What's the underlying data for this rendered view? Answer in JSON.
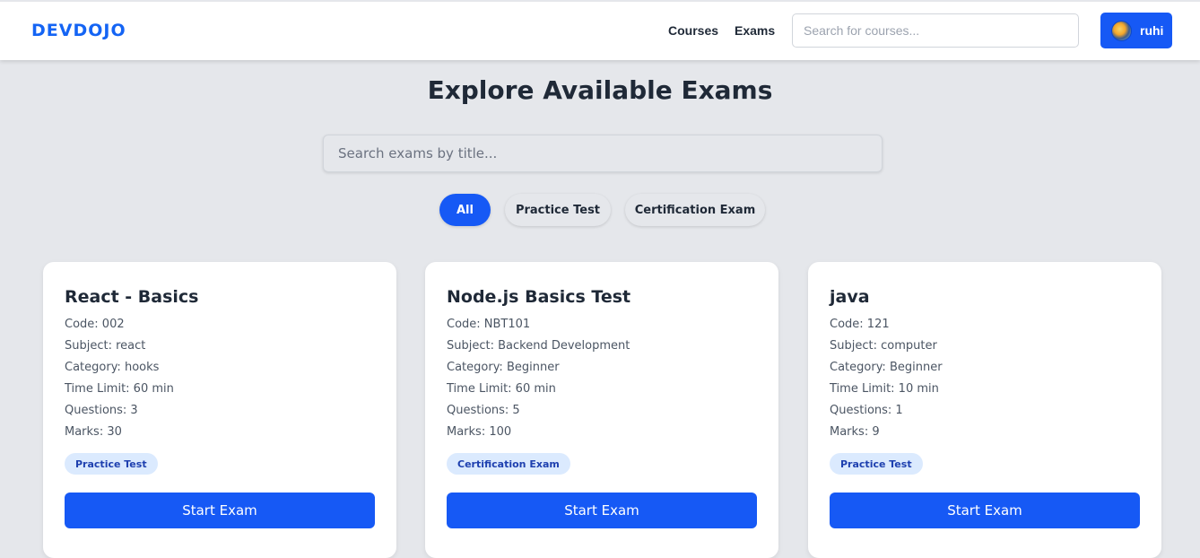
{
  "navbar": {
    "logo": "DEVDOJO",
    "links": [
      "Courses",
      "Exams"
    ],
    "search_placeholder": "Search for courses...",
    "user_name": "ruhi",
    "avatar_icon": "user-avatar-icon"
  },
  "page": {
    "title": "Explore Available Exams",
    "search_placeholder": "Search exams by title..."
  },
  "filters": {
    "items": [
      "All",
      "Practice Test",
      "Certification Exam"
    ],
    "active": "All"
  },
  "exams": [
    {
      "title": "React - Basics",
      "code": "Code: 002",
      "subject": "Subject: react",
      "category": "Category: hooks",
      "time_limit": "Time Limit: 60 min",
      "questions": "Questions: 3",
      "marks": "Marks: 30",
      "type": "Practice Test",
      "button": "Start Exam"
    },
    {
      "title": "Node.js Basics Test",
      "code": "Code: NBT101",
      "subject": "Subject: Backend Development",
      "category": "Category: Beginner",
      "time_limit": "Time Limit: 60 min",
      "questions": "Questions: 5",
      "marks": "Marks: 100",
      "type": "Certification Exam",
      "button": "Start Exam"
    },
    {
      "title": "java",
      "code": "Code: 121",
      "subject": "Subject: computer",
      "category": "Category: Beginner",
      "time_limit": "Time Limit: 10 min",
      "questions": "Questions: 1",
      "marks": "Marks: 9",
      "type": "Practice Test",
      "button": "Start Exam"
    }
  ],
  "colors": {
    "primary": "#1659f5",
    "logo": "#1464f4",
    "background": "#e5e7eb",
    "badge_bg": "#dbeafe",
    "badge_text": "#1e40af"
  }
}
